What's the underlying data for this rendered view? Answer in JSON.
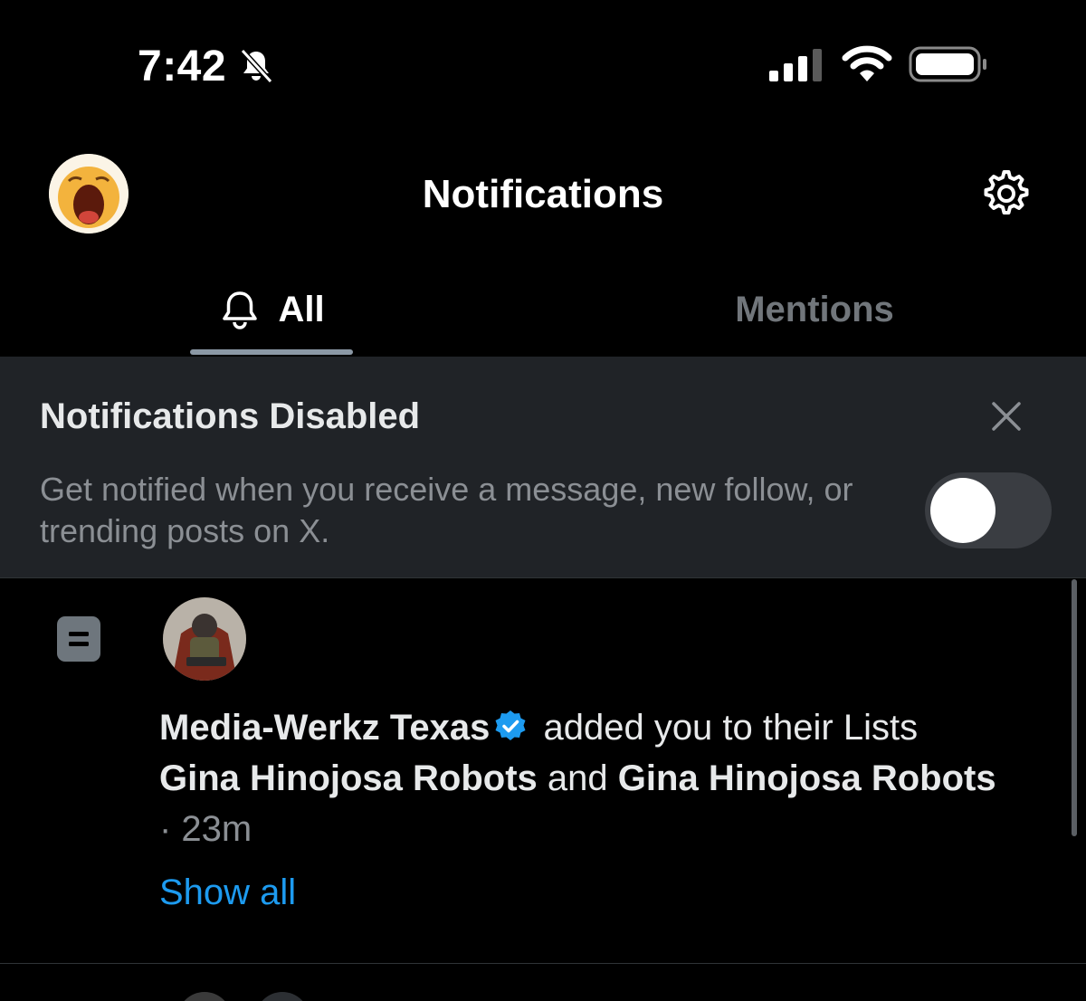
{
  "status_bar": {
    "time": "7:42",
    "icons": [
      "bell-off-icon",
      "signal-icon",
      "wifi-icon",
      "battery-icon"
    ]
  },
  "header": {
    "title": "Notifications",
    "avatar_icon": "crying-emoji-avatar",
    "settings_icon": "gear-icon"
  },
  "tabs": [
    {
      "label": "All",
      "icon": "bell-icon",
      "active": true
    },
    {
      "label": "Mentions",
      "active": false
    }
  ],
  "banner": {
    "title": "Notifications Disabled",
    "body": "Get notified when you receive a message, new follow, or trending posts on X.",
    "toggle_on": false
  },
  "notification": {
    "type_icon": "list-icon",
    "user_name": "Media-Werkz Texas",
    "verified": true,
    "action_text": "added you to their Lists",
    "list_1": "Gina Hinojosa Robots",
    "conjunction": "and",
    "list_2": "Gina Hinojosa Robots",
    "time": "· 23m",
    "show_all_label": "Show all"
  },
  "colors": {
    "background": "#000000",
    "banner_background": "#202327",
    "accent_blue": "#1d9bf0",
    "muted_text": "#71767b",
    "primary_text": "#e7e9ea"
  }
}
